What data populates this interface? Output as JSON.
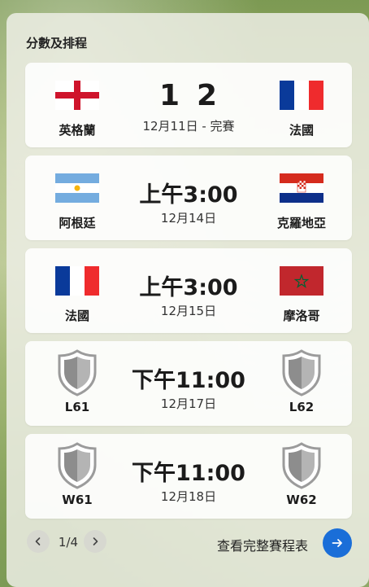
{
  "widget": {
    "title": "分數及排程",
    "colors": {
      "accent": "#1a6ed8",
      "card_bg": "#ffffff",
      "panel_bg": "#eceee4"
    }
  },
  "matches": [
    {
      "home": {
        "name": "英格蘭",
        "icon": "england-flag-icon"
      },
      "away": {
        "name": "法國",
        "icon": "france-flag-icon"
      },
      "score_home": "1",
      "score_away": "2",
      "status": "12月11日 - 完賽"
    },
    {
      "home": {
        "name": "阿根廷",
        "icon": "argentina-flag-icon"
      },
      "away": {
        "name": "克羅地亞",
        "icon": "croatia-flag-icon"
      },
      "time": "上午3:00",
      "date": "12月14日"
    },
    {
      "home": {
        "name": "法國",
        "icon": "france-flag-icon"
      },
      "away": {
        "name": "摩洛哥",
        "icon": "morocco-flag-icon"
      },
      "time": "上午3:00",
      "date": "12月15日"
    },
    {
      "home": {
        "name": "L61",
        "icon": "shield-placeholder-icon"
      },
      "away": {
        "name": "L62",
        "icon": "shield-placeholder-icon"
      },
      "time": "下午11:00",
      "date": "12月17日"
    },
    {
      "home": {
        "name": "W61",
        "icon": "shield-placeholder-icon"
      },
      "away": {
        "name": "W62",
        "icon": "shield-placeholder-icon"
      },
      "time": "下午11:00",
      "date": "12月18日"
    }
  ],
  "footer": {
    "page_indicator": "1/4",
    "prev_icon": "chevron-left-icon",
    "next_icon": "chevron-right-icon",
    "full_schedule_label": "查看完整賽程表",
    "go_icon": "arrow-right-icon"
  }
}
